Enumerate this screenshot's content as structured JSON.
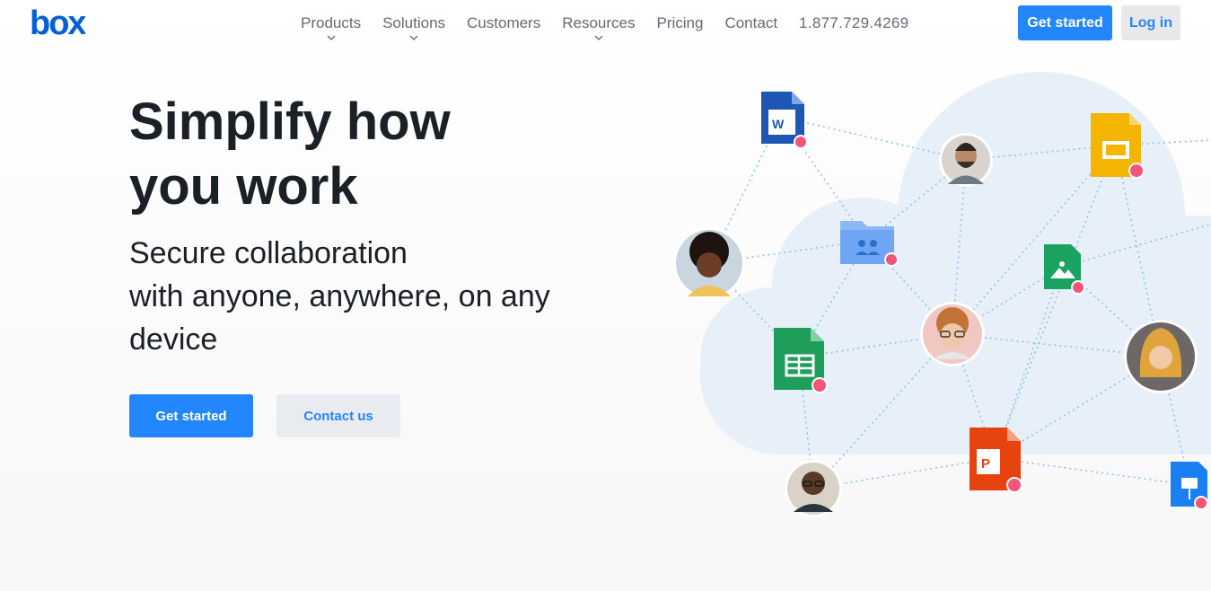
{
  "brand": {
    "logo_text": "box",
    "color": "#0061d5"
  },
  "nav": {
    "items": [
      {
        "label": "Products",
        "has_dropdown": true
      },
      {
        "label": "Solutions",
        "has_dropdown": true
      },
      {
        "label": "Customers",
        "has_dropdown": false
      },
      {
        "label": "Resources",
        "has_dropdown": true
      },
      {
        "label": "Pricing",
        "has_dropdown": false
      },
      {
        "label": "Contact",
        "has_dropdown": false
      }
    ],
    "phone": "1.877.729.4269"
  },
  "header_actions": {
    "get_started": "Get started",
    "log_in": "Log in"
  },
  "hero": {
    "headline_line1": "Simplify how",
    "headline_line2": "you work",
    "subhead_line1": "Secure collaboration",
    "subhead_line2": "with anyone, anywhere, on any",
    "subhead_line3": "device",
    "primary_cta": "Get started",
    "secondary_cta": "Contact us"
  },
  "illustration": {
    "file_icons": [
      "word-doc-icon",
      "google-slides-icon",
      "shared-folder-icon",
      "image-file-icon",
      "google-sheets-icon",
      "powerpoint-icon",
      "keynote-icon"
    ],
    "word_badge": "W",
    "powerpoint_badge": "P"
  },
  "colors": {
    "accent": "#2486fc",
    "text_dark": "#1b2026",
    "nav_text": "#646b73",
    "lock_badge": "#f2557a",
    "cloud": "#e7eff9",
    "connector": "#8ec2ee"
  }
}
